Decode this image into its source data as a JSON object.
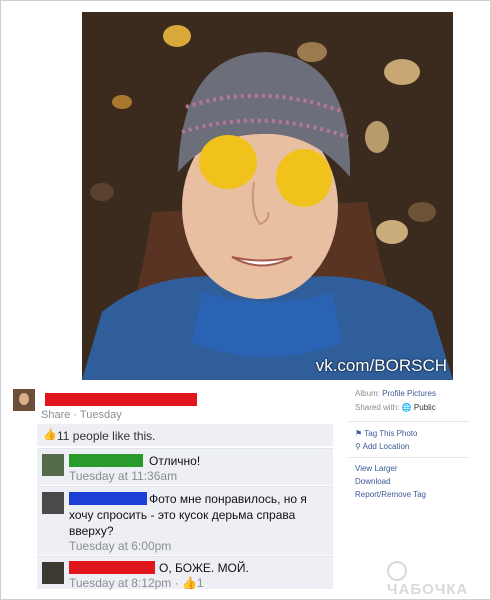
{
  "photo": {
    "watermark": "vk.com/BORSCH"
  },
  "post": {
    "share_line": "Share · Tuesday",
    "likes_text": "11 people like this.",
    "like_icon": "thumbs-up-icon",
    "redact_color": "#e0161c"
  },
  "comments": [
    {
      "text": "Отлично!",
      "time": "Tuesday at 11:36am",
      "redact_color": "#2a9b2a"
    },
    {
      "text": "Фото мне понравилось, но я хочу спросить - это кусок дерьма справа вверху?",
      "time": "Tuesday at 6:00pm",
      "redact_color": "#1d3fd6"
    },
    {
      "text": "О, БОЖЕ. МОЙ.",
      "time": "Tuesday at 8:12pm · ",
      "likes": "1",
      "redact_color": "#e0161c"
    }
  ],
  "sidebar": {
    "album_label": "Album:",
    "album_value": "Profile Pictures",
    "shared_label": "Shared with:",
    "shared_value": "Public",
    "tag_photo": "Tag This Photo",
    "add_location": "Add Location",
    "view_larger": "View Larger",
    "download": "Download",
    "report": "Report/Remove Tag"
  },
  "brand_logo": "ЧАБОЧКА"
}
